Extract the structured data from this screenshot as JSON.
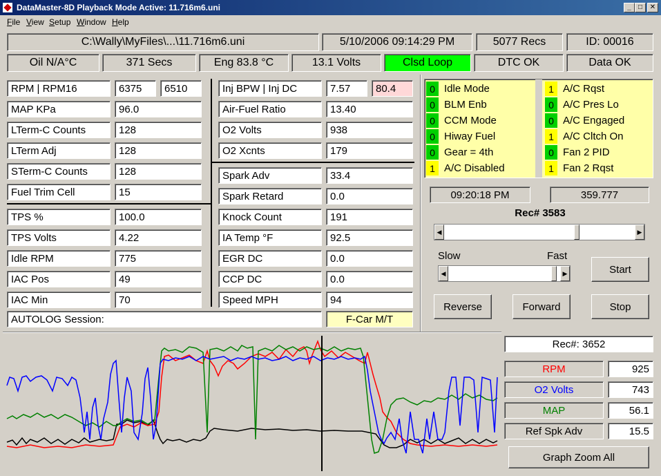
{
  "window": {
    "title": "DataMaster-8D  Playback Mode Active: 11.716m6.uni"
  },
  "menu": [
    "File",
    "View",
    "Setup",
    "Window",
    "Help"
  ],
  "header": {
    "file": "C:\\Wally\\MyFiles\\...\\11.716m6.uni",
    "datetime": "5/10/2006  09:14:29 PM",
    "recs": "5077 Recs",
    "id": "ID:  00016"
  },
  "status": {
    "oil": "Oil  N/A°C",
    "secs": "371 Secs",
    "eng": "Eng  83.8 °C",
    "volts": "13.1 Volts",
    "loop": "Clsd Loop",
    "dtc": "DTC OK",
    "data": "Data OK",
    "loop_color": "#00ff00"
  },
  "params_left": [
    {
      "label": "RPM   |   RPM16",
      "value": "6375",
      "value2": "6510"
    },
    {
      "label": "MAP KPa",
      "value": "96.0"
    },
    {
      "label": "LTerm-C Counts",
      "value": "128"
    },
    {
      "label": "LTerm Adj",
      "value": "128"
    },
    {
      "label": "STerm-C Counts",
      "value": "128"
    },
    {
      "label": "Fuel Trim Cell",
      "value": "15"
    },
    {
      "label": "TPS %",
      "value": "100.0"
    },
    {
      "label": "TPS Volts",
      "value": "4.22"
    },
    {
      "label": "Idle RPM",
      "value": "775"
    },
    {
      "label": "IAC Pos",
      "value": "49"
    },
    {
      "label": "IAC Min",
      "value": "70"
    }
  ],
  "params_mid": [
    {
      "label": "Inj BPW  |  Inj DC",
      "value": "7.57",
      "value2": "80.4"
    },
    {
      "label": "Air-Fuel Ratio",
      "value": "13.40"
    },
    {
      "label": "O2 Volts",
      "value": "938"
    },
    {
      "label": "O2 Xcnts",
      "value": "179"
    },
    {
      "label": "Spark Adv",
      "value": "33.4"
    },
    {
      "label": "Spark Retard",
      "value": "0.0"
    },
    {
      "label": "Knock Count",
      "value": "191"
    },
    {
      "label": "IA Temp °F",
      "value": "92.5"
    },
    {
      "label": "EGR DC",
      "value": "0.0"
    },
    {
      "label": "CCP DC",
      "value": "0.0"
    },
    {
      "label": "Speed MPH",
      "value": "94"
    }
  ],
  "autolog": {
    "label": "AUTOLOG Session:",
    "car": "F-Car M/T"
  },
  "flags_left": [
    {
      "num": "0",
      "label": "Idle Mode"
    },
    {
      "num": "0",
      "label": "BLM Enb"
    },
    {
      "num": "0",
      "label": "CCM Mode"
    },
    {
      "num": "0",
      "label": "Hiway Fuel"
    },
    {
      "num": "0",
      "label": "Gear = 4th"
    },
    {
      "num": "1",
      "label": "A/C Disabled"
    }
  ],
  "flags_right": [
    {
      "num": "1",
      "label": "A/C Rqst"
    },
    {
      "num": "0",
      "label": "A/C Pres Lo"
    },
    {
      "num": "0",
      "label": "A/C Engaged"
    },
    {
      "num": "1",
      "label": "A/C Cltch On"
    },
    {
      "num": "0",
      "label": "Fan 2 PID"
    },
    {
      "num": "1",
      "label": "Fan 2 Rqst"
    }
  ],
  "flag_colors": {
    "0": "#00d000",
    "1": "#ffff00"
  },
  "playback": {
    "time": "09:20:18 PM",
    "seconds": "359.777",
    "rec": "Rec# 3583",
    "slow": "Slow",
    "fast": "Fast",
    "start": "Start",
    "reverse": "Reverse",
    "forward": "Forward",
    "stop": "Stop",
    "position_fraction": 0.7,
    "speed_fraction": 0.97
  },
  "graph": {
    "rec": "Rec#:  3652",
    "legend": [
      {
        "name": "RPM",
        "value": "925",
        "color": "#ff0000"
      },
      {
        "name": "O2 Volts",
        "value": "743",
        "color": "#0000ff"
      },
      {
        "name": "MAP",
        "value": "56.1",
        "color": "#008000"
      },
      {
        "name": "Ref Spk Adv",
        "value": "15.5",
        "color": "#000000"
      }
    ],
    "zoom": "Graph Zoom All"
  }
}
